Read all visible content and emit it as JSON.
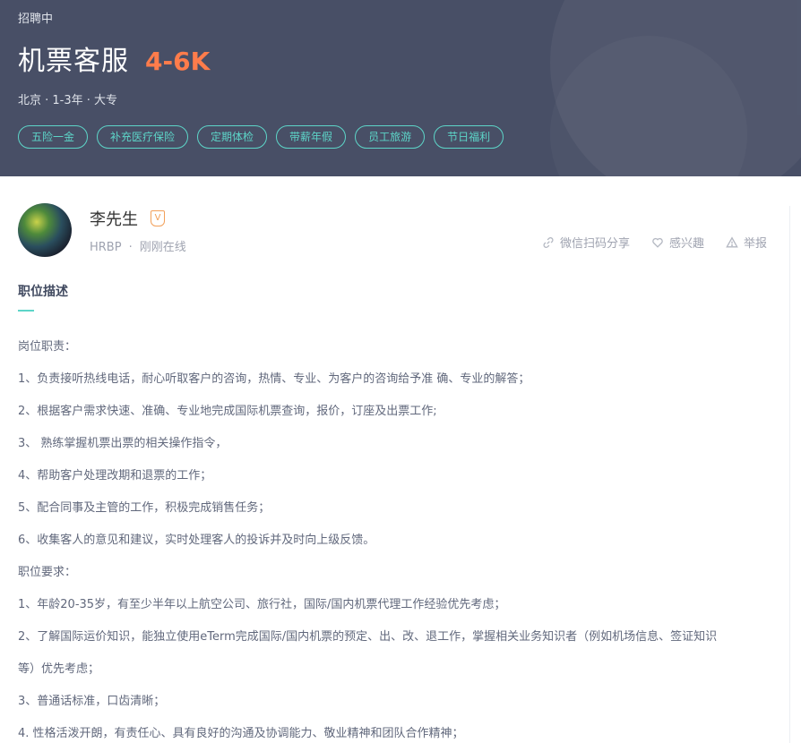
{
  "header": {
    "status": "招聘中",
    "title": "机票客服",
    "salary": "4-6K",
    "meta": "北京 · 1-3年 · 大专",
    "tags": [
      "五险一金",
      "补充医疗保险",
      "定期体检",
      "带薪年假",
      "员工旅游",
      "节日福利"
    ]
  },
  "recruiter": {
    "name": "李先生",
    "badge": "V",
    "role": "HRBP",
    "separator": "·",
    "status": "刚刚在线"
  },
  "actions": {
    "share": "微信扫码分享",
    "interest": "感兴趣",
    "report": "举报"
  },
  "description": {
    "title": "职位描述",
    "lines": [
      "岗位职责：",
      "1、负责接听热线电话，耐心听取客户的咨询，热情、专业、为客户的咨询给予准 确、专业的解答；",
      "2、根据客户需求快速、准确、专业地完成国际机票查询，报价，订座及出票工作;",
      "3、 熟练掌握机票出票的相关操作指令，",
      "4、帮助客户处理改期和退票的工作；",
      "5、配合同事及主管的工作，积极完成销售任务；",
      "6、收集客人的意见和建议，实时处理客人的投诉并及时向上级反馈。",
      "职位要求：",
      "1、年龄20-35岁，有至少半年以上航空公司、旅行社，国际/国内机票代理工作经验优先考虑；",
      "2、了解国际运价知识，能独立使用eTerm完成国际/国内机票的预定、出、改、退工作，掌握相关业务知识者（例如机场信息、签证知识",
      "等）优先考虑；",
      "3、普通话标准，口齿清晰；",
      "4. 性格活泼开朗，有责任心、具有良好的沟通及协调能力、敬业精神和团队合作精神；"
    ]
  }
}
